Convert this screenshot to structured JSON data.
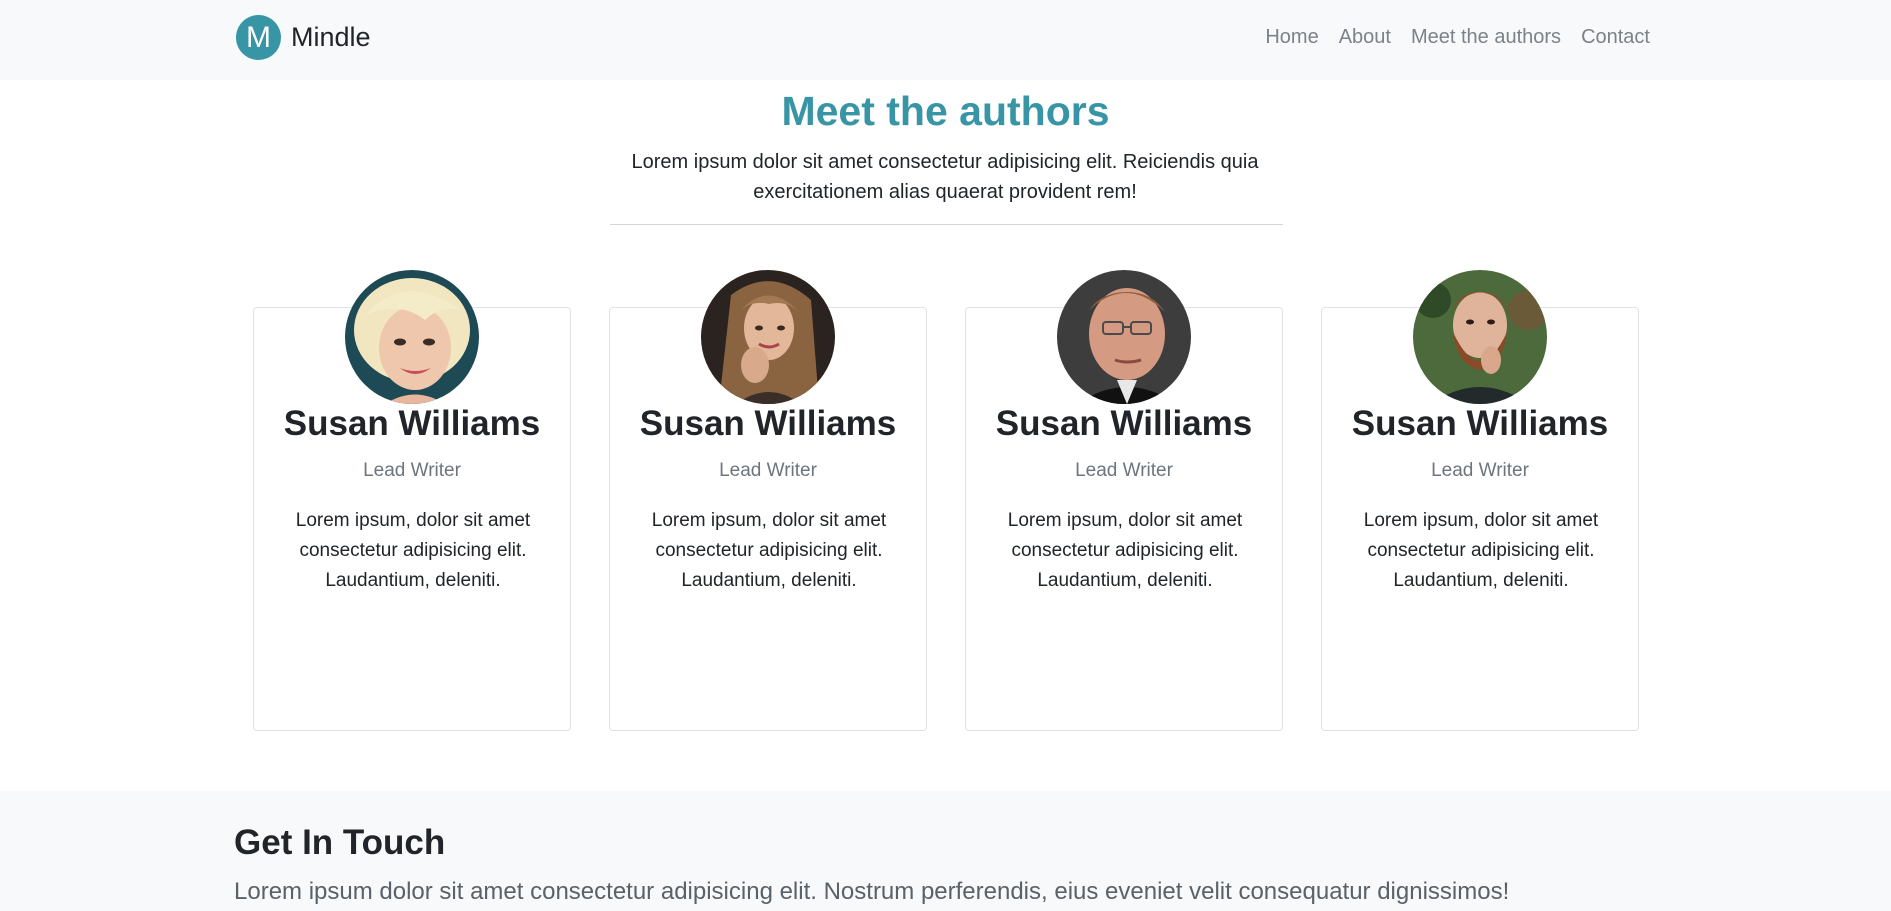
{
  "navbar": {
    "brand_initial": "M",
    "brand_name": "Mindle",
    "links": [
      "Home",
      "About",
      "Meet the authors",
      "Contact"
    ]
  },
  "authors_section": {
    "title": "Meet the authors",
    "lead": "Lorem ipsum dolor sit amet consectetur adipisicing elit. Reiciendis quia exercitationem alias quaerat provident rem!",
    "cards": [
      {
        "name": "Susan Williams",
        "role": "Lead Writer",
        "bio": "Lorem ipsum, dolor sit amet consectetur adipisicing elit. Laudantium, deleniti.",
        "avatar": "woman-short-blonde-hair-portrait"
      },
      {
        "name": "Susan Williams",
        "role": "Lead Writer",
        "bio": "Lorem ipsum, dolor sit amet consectetur adipisicing elit. Laudantium, deleniti.",
        "avatar": "woman-long-hair-portrait"
      },
      {
        "name": "Susan Williams",
        "role": "Lead Writer",
        "bio": "Lorem ipsum, dolor sit amet consectetur adipisicing elit. Laudantium, deleniti.",
        "avatar": "man-glasses-portrait"
      },
      {
        "name": "Susan Williams",
        "role": "Lead Writer",
        "bio": "Lorem ipsum, dolor sit amet consectetur adipisicing elit. Laudantium, deleniti.",
        "avatar": "bearded-man-portrait"
      }
    ]
  },
  "get_in_touch": {
    "title": "Get In Touch",
    "text": "Lorem ipsum dolor sit amet consectetur adipisicing elit. Nostrum perferendis, eius eveniet velit consequatur dignissimos!"
  },
  "colors": {
    "accent": "#3795a5",
    "navbar_bg": "#f8f9fa",
    "muted": "#6c757d"
  }
}
